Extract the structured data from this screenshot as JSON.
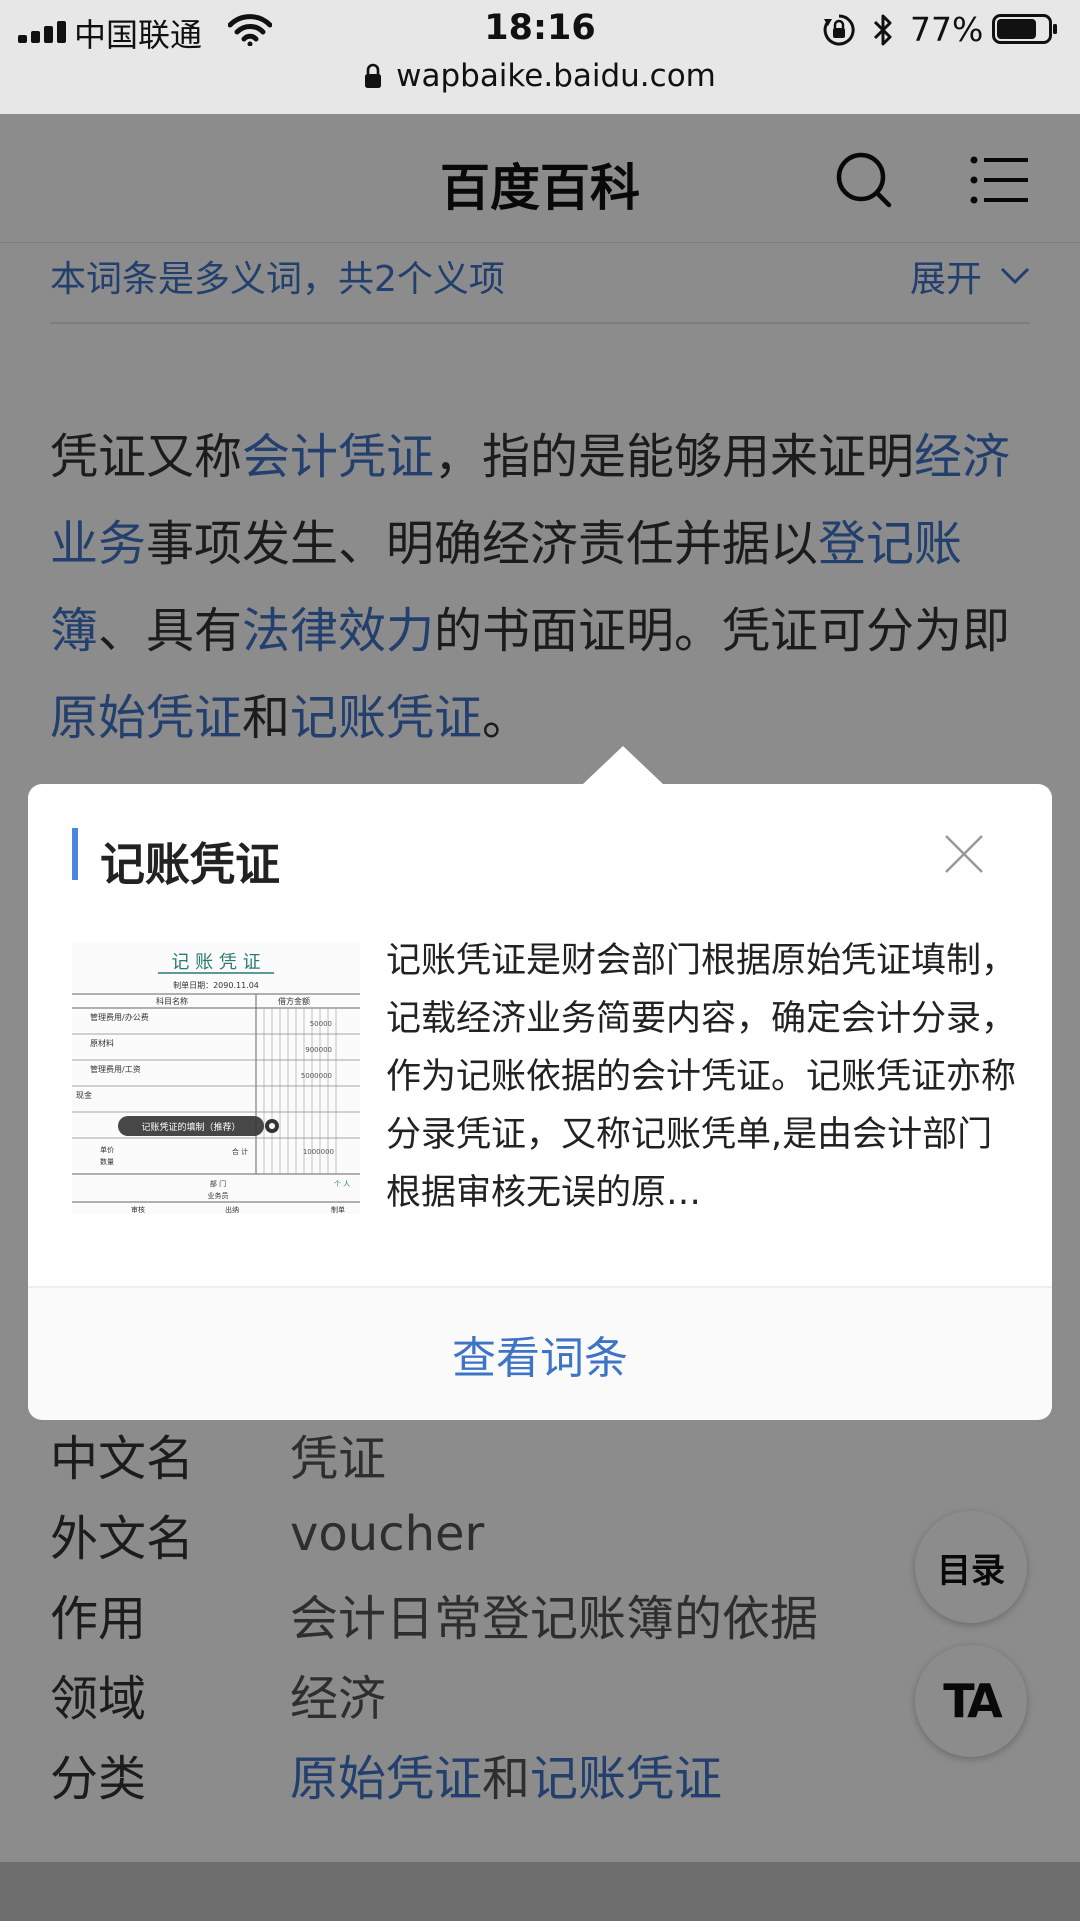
{
  "status_bar": {
    "carrier": "中国联通",
    "time": "18:16",
    "battery_percent": "77%",
    "battery_level": 0.77,
    "icons": [
      "signal-icon",
      "wifi-icon",
      "rotation-lock-icon",
      "bluetooth-icon",
      "battery-icon"
    ]
  },
  "browser": {
    "url": "wapbaike.baidu.com",
    "lock_icon": "padlock-icon"
  },
  "header": {
    "title": "百度百科",
    "search_icon": "search-icon",
    "menu_icon": "menu-icon"
  },
  "polysemy": {
    "text": "本词条是多义词，共2个义项",
    "expand_label": "展开"
  },
  "intro": {
    "segments": [
      {
        "text": "凭证又称",
        "link": false
      },
      {
        "text": "会计凭证",
        "link": true
      },
      {
        "text": "，指的是能够用来证明",
        "link": false
      },
      {
        "text": "经济业务",
        "link": true
      },
      {
        "text": "事项发生、明确经济责任并据以",
        "link": false
      },
      {
        "text": "登记账簿",
        "link": true
      },
      {
        "text": "、具有",
        "link": false
      },
      {
        "text": "法律效力",
        "link": true
      },
      {
        "text": "的书面证明。凭证可分为即",
        "link": false
      },
      {
        "text": "原始凭证",
        "link": true
      },
      {
        "text": "和",
        "link": false
      },
      {
        "text": "记账凭证",
        "link": true
      },
      {
        "text": "。",
        "link": false
      }
    ]
  },
  "infobox": {
    "rows": [
      {
        "key": "中文名",
        "value": "凭证"
      },
      {
        "key": "外文名",
        "value": "voucher"
      },
      {
        "key": "作用",
        "value": "会计日常登记账簿的依据"
      },
      {
        "key": "领域",
        "value": "经济"
      }
    ],
    "category": {
      "key": "分类",
      "link1": "原始凭证",
      "joiner": "和",
      "link2": "记账凭证"
    }
  },
  "side_buttons": {
    "catalog": "目录",
    "ta": "TA"
  },
  "popup": {
    "title": "记账凭证",
    "description": "记账凭证是财会部门根据原始凭证填制，记载经济业务简要内容，确定会计分录，作为记账依据的会计凭证。记账凭证亦称分录凭证，又称记账凭单,是由会计部门根据审核无误的原…",
    "thumb": {
      "heading": "记 账 凭 证",
      "date_line": "制单日期：2090.11.04",
      "col1": "科目名称",
      "col2": "借方金额",
      "rows": [
        "管理费用/办公费",
        "原材料",
        "管理费用/工资",
        "现金"
      ],
      "amounts": [
        "50000",
        "900000",
        "5000000"
      ],
      "play_label": "记账凭证的填制（推荐）",
      "row_units": "单价",
      "row_qty": "数量",
      "total": "合  计",
      "total_amount": "1000000",
      "dept": "部  门",
      "dept2": "业务员",
      "person": "个  人",
      "footer": [
        "审核",
        "出纳",
        "制单"
      ]
    },
    "footer_label": "查看词条"
  },
  "colors": {
    "link": "#3e74c6",
    "accent": "#4a86e0",
    "overlay": "rgba(0,0,0,0.45)"
  }
}
